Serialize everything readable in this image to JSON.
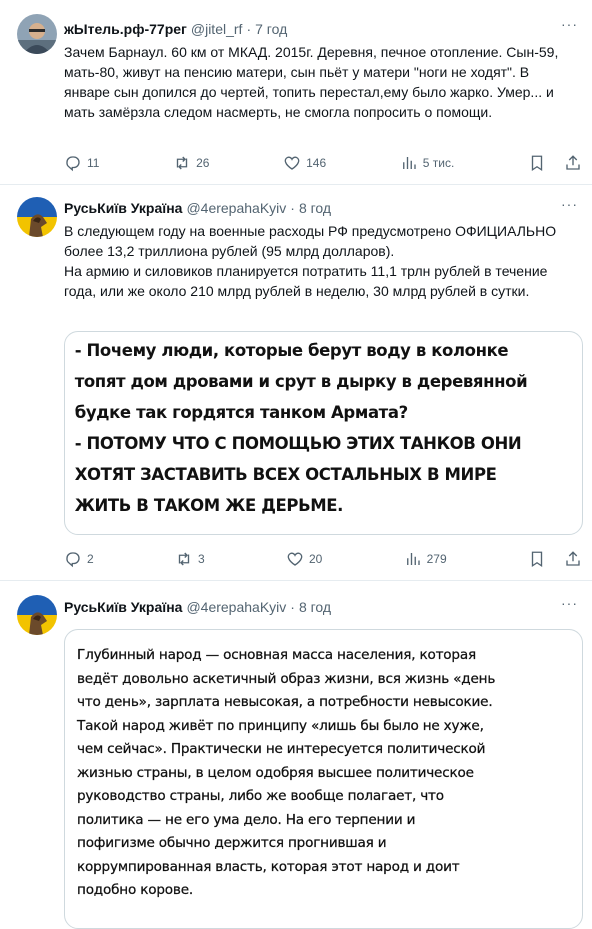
{
  "tweets": [
    {
      "name": "жЫтель.рф-77рег",
      "handle": "@jitel_rf",
      "time": "7 год",
      "more": "···",
      "text": [
        "Зачем Барнаул. 60 км от МКАД. 2015г. Деревня, печное отопление. Сын-59, мать-80, живут на пенсию матери, сын пьёт у матери \"ноги не ходят\". В январе сын допился до чертей, топить перестал,ему было жарко. Умер... и мать замёрзла следом насмерть, не смогла попросить о помощи."
      ],
      "replies": "11",
      "retweets": "26",
      "likes": "146",
      "views": "5 тис."
    },
    {
      "name": "РусьКиїв Україна",
      "handle": "@4erepahaKyiv",
      "time": "8 год",
      "more": "···",
      "text": [
        "В следующем году на военные расходы РФ предусмотрено ОФИЦИАЛЬНО более 13,2 триллиона рублей (95 млрд долларов).",
        "На армию и силовиков планируется потратить 11,1 трлн рублей в течение года, или же около 210 млрд рублей в неделю, 30 млрд рублей в сутки."
      ],
      "image_text": [
        "- Почему люди, которые берут воду в колонке",
        "топят дом дровами и срут в дырку в деревянной",
        "будке так гордятся танком Армата?",
        "- ПОТОМУ ЧТО С ПОМОЩЬЮ ЭТИХ ТАНКОВ ОНИ",
        "ХОТЯТ ЗАСТАВИТЬ ВСЕХ ОСТАЛЬНЫХ В МИРЕ",
        "ЖИТЬ В ТАКОМ ЖЕ ДЕРЬМЕ."
      ],
      "replies": "2",
      "retweets": "3",
      "likes": "20",
      "views": "279"
    },
    {
      "name": "РусьКиїв Україна",
      "handle": "@4erepahaKyiv",
      "time": "8 год",
      "more": "···",
      "image_text": [
        "Глубинный народ — основная масса населения, которая",
        "ведёт довольно аскетичный образ жизни, вся жизнь «день",
        "что день», зарплата невысокая, а потребности невысокие.",
        "Такой народ живёт по принципу «лишь бы было не хуже,",
        "чем сейчас». Практически не интересуется политической",
        "жизнью страны, в целом одобряя высшее политическое",
        "руководство страны, либо же вообще полагает, что",
        "политика — не его ума дело. На его терпении и",
        "пофигизме обычно держится прогнившая и",
        "коррумпированная власть, которая этот народ и доит",
        "подобно корове."
      ]
    }
  ],
  "colors": {
    "text": "#0f1419",
    "muted": "#536471",
    "border": "#cfd9de",
    "flag_blue": "#1f5fb4",
    "flag_yellow": "#f2c300"
  }
}
